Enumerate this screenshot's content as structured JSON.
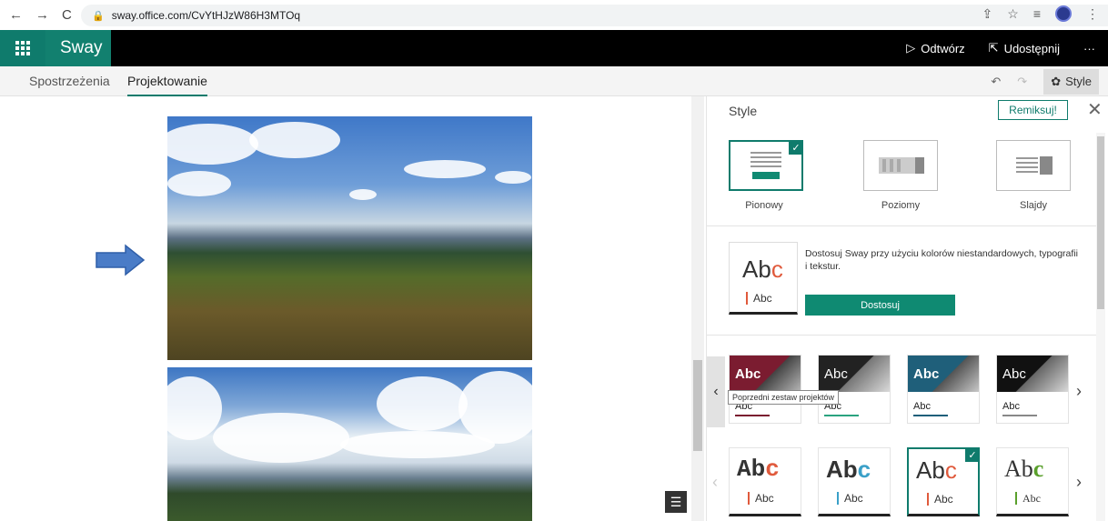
{
  "browser": {
    "url": "sway.office.com/CvYtHJzW86H3MTOq",
    "nav_icons": [
      "back-arrow-icon",
      "forward-arrow-icon",
      "reload-icon"
    ]
  },
  "topbar": {
    "brand": "Sway",
    "play_label": "Odtwórz",
    "share_label": "Udostępnij",
    "more_label": "···"
  },
  "tabs": {
    "insights": "Spostrzeżenia",
    "design": "Projektowanie",
    "style_label": "Style"
  },
  "panel": {
    "title": "Style",
    "remix_label": "Remiksuj!",
    "layouts": [
      {
        "label": "Pionowy",
        "selected": true
      },
      {
        "label": "Poziomy",
        "selected": false
      },
      {
        "label": "Slajdy",
        "selected": false
      }
    ],
    "customize": {
      "sample_big_a": "Ab",
      "sample_big_c": "c",
      "sample_small": "Abc",
      "description": "Dostosuj Sway przy użyciu kolorów niestandardowych, typografii i tekstur.",
      "button_label": "Dostosuj"
    },
    "tooltip": "Poprzedni zestaw projektów",
    "themes_row1": [
      {
        "top": "Abc",
        "bottom": "Abc",
        "accent": "#7b1c30"
      },
      {
        "top": "Abc",
        "bottom": "Abc",
        "accent": "#2aa37f"
      },
      {
        "top": "Abc",
        "bottom": "Abc",
        "accent": "#1f5f7a"
      },
      {
        "top": "Abc",
        "bottom": "Abc",
        "accent": "#888888"
      }
    ],
    "themes_row2": [
      {
        "a": "Ab",
        "c": "c",
        "small": "Abc",
        "accent": "#e05a3c"
      },
      {
        "a": "Ab",
        "c": "c",
        "small": "Abc",
        "accent": "#3aa0c8"
      },
      {
        "a": "Ab",
        "c": "c",
        "small": "Abc",
        "accent": "#e05a3c"
      },
      {
        "a": "Ab",
        "c": "c",
        "small": "Abc",
        "accent": "#5aa02c"
      }
    ]
  },
  "colors": {
    "brand_green": "#0f7b6c",
    "arrow_blue": "#4a7cc7"
  }
}
